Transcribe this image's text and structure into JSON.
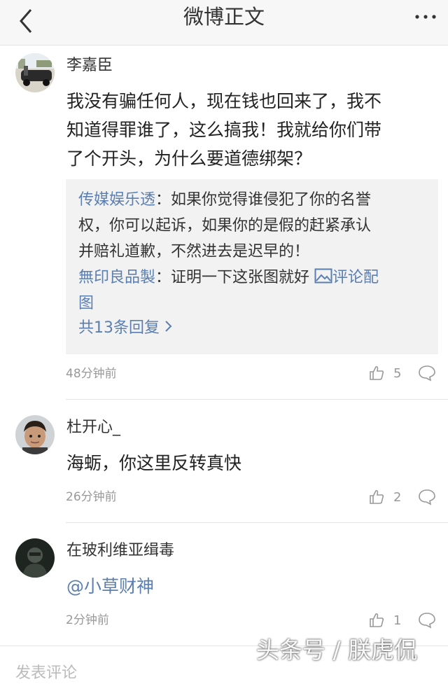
{
  "header": {
    "title": "微博正文",
    "back_icon": "chevron-left-icon",
    "more_icon": "more-dots-icon"
  },
  "comments": [
    {
      "user": "李嘉臣",
      "lines": [
        "我没有骗任何人，现在钱也回来了，我不",
        "知道得罪谁了，这么搞我！我就给你们带",
        "了个开头，为什么要道德绑架？"
      ],
      "replies": [
        {
          "user": "传媒娱乐透",
          "lines": [
            "：如果你觉得谁侵犯了你的名誉",
            "权，你可以起诉，如果你的是假的赶紧承认",
            "并赔礼道歉，不然进去是迟早的！"
          ]
        },
        {
          "user": "無印良品製",
          "text": "：证明一下这张图就好",
          "pic_link_1": "评论配",
          "pic_link_2": "图"
        }
      ],
      "more_replies": "共13条回复",
      "time": "48分钟前",
      "likes": "5"
    },
    {
      "user": "杜开心_",
      "text": "海蛎，你这里反转真快",
      "time": "26分钟前",
      "likes": "2"
    },
    {
      "user": "在玻利维亚缉毒",
      "text": "@小草财神",
      "time": "2分钟前",
      "likes": "1"
    }
  ],
  "bottom": {
    "input_placeholder": "发表评论"
  },
  "watermark": "头条号 / 朕虎侃",
  "colors": {
    "link": "#5b7fb0",
    "meta": "#999999",
    "reply_bg": "#f2f2f2"
  }
}
